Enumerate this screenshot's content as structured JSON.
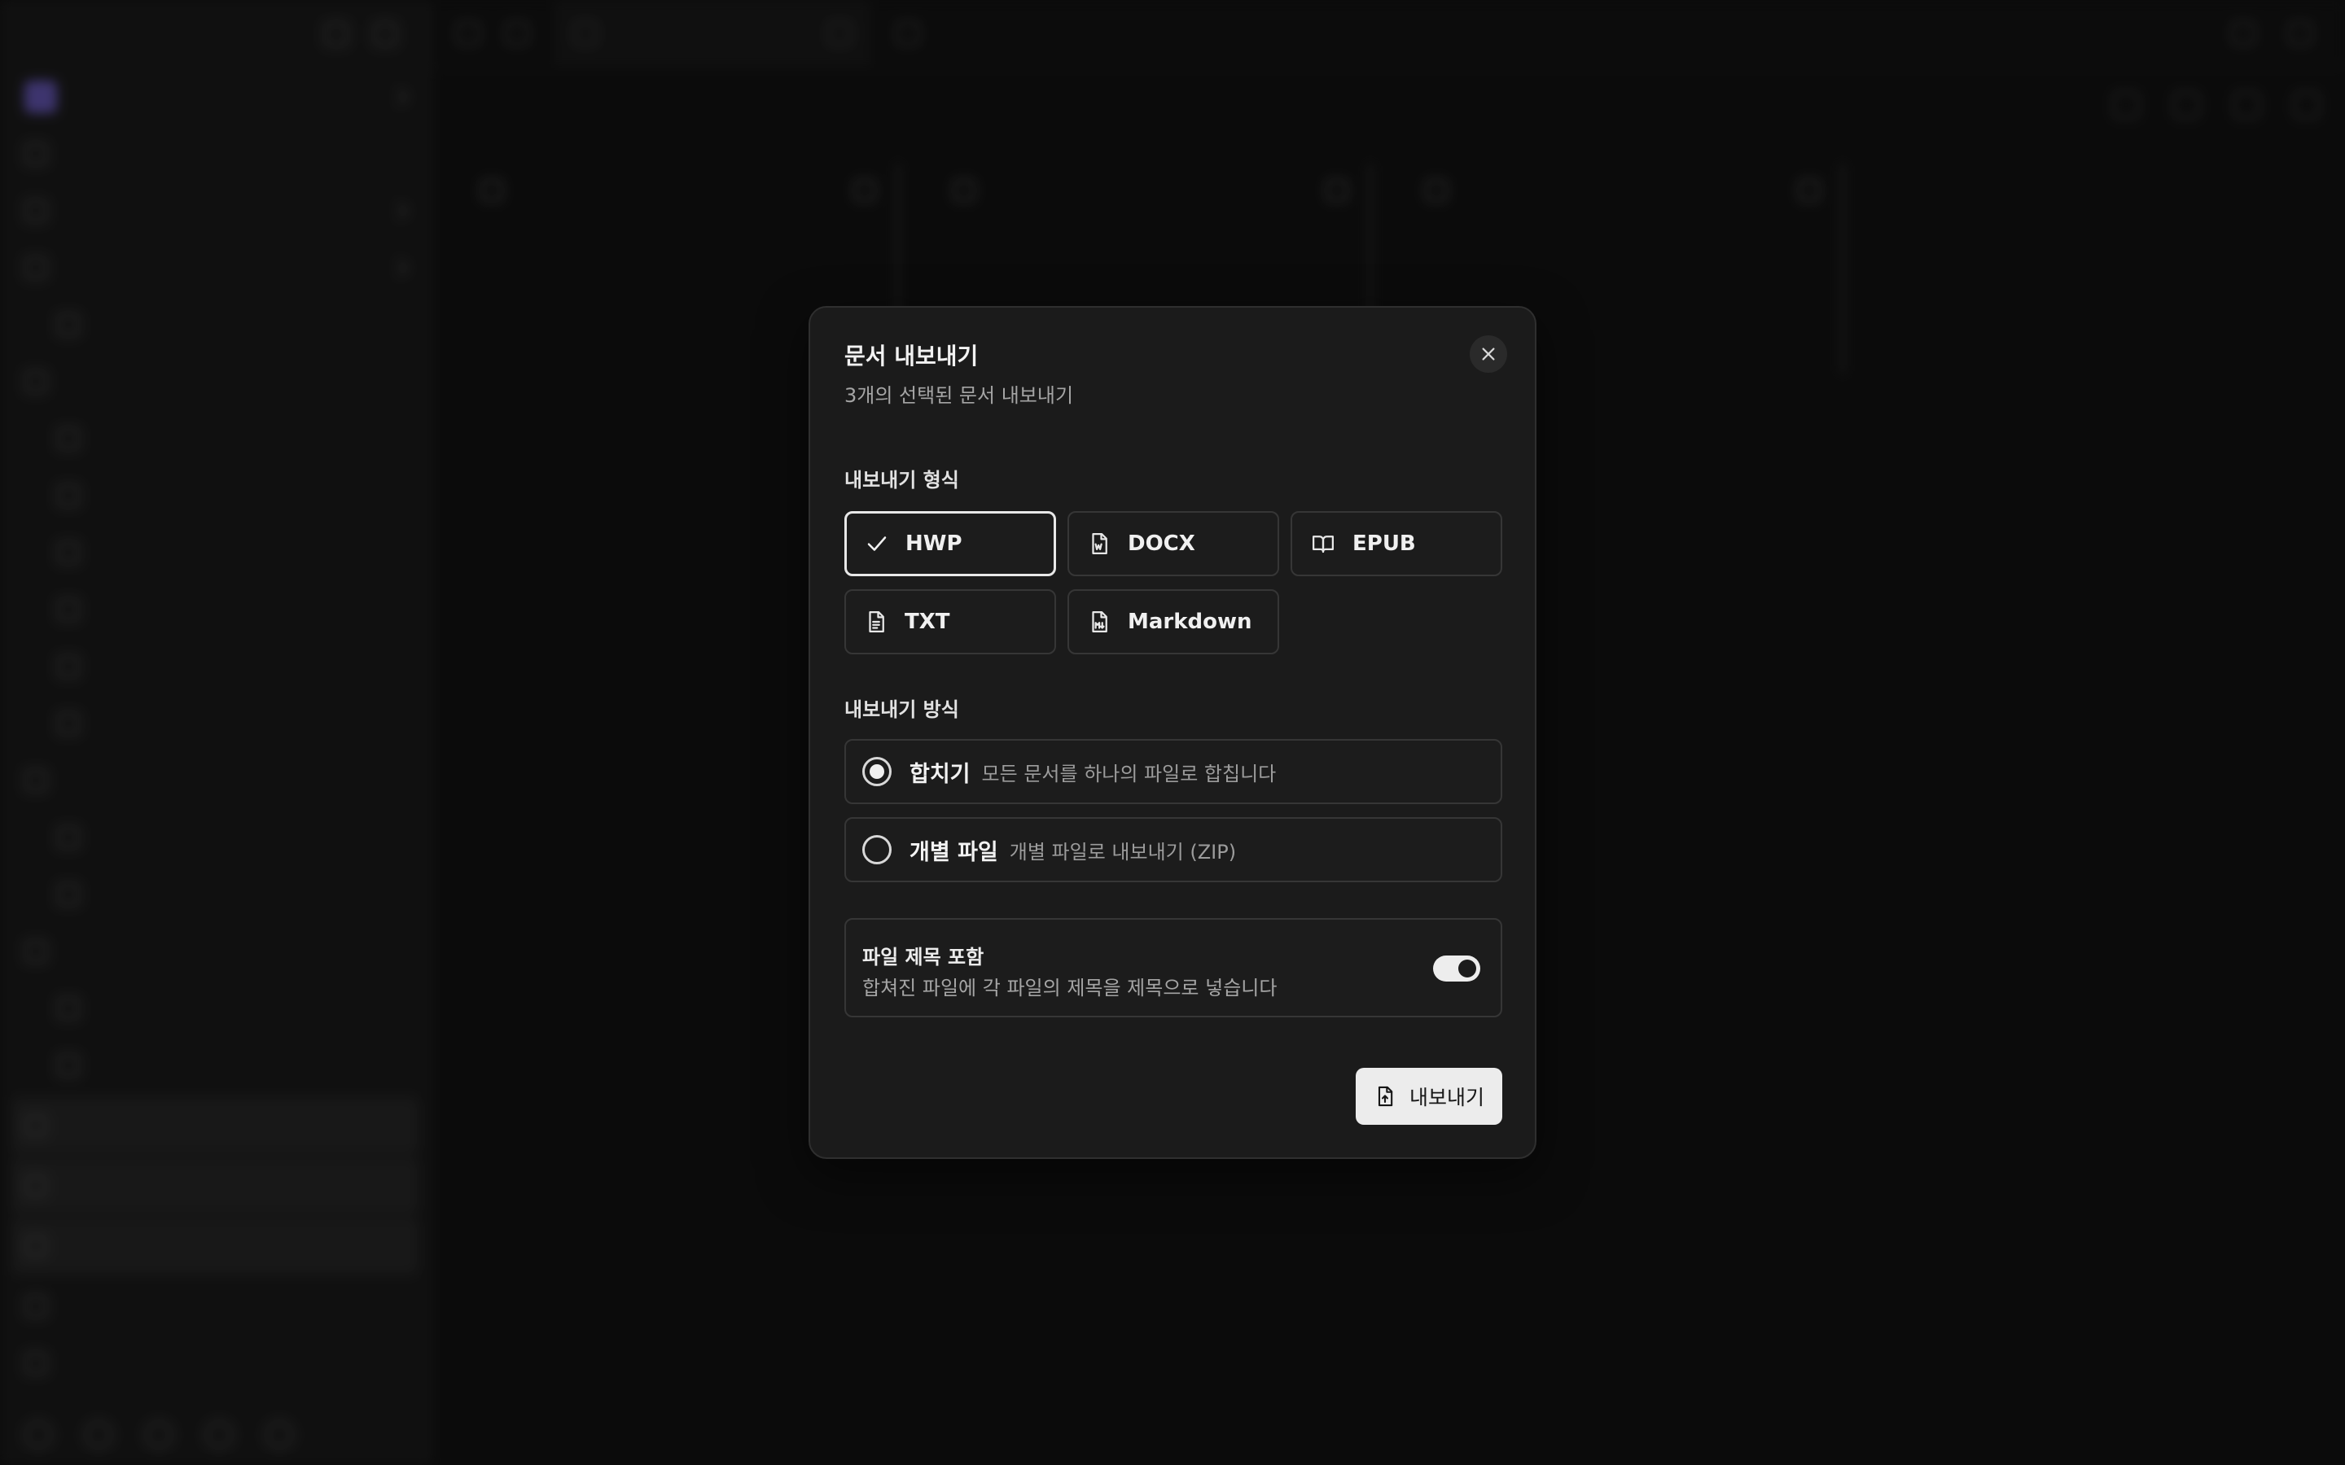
{
  "dialog": {
    "title": "문서 내보내기",
    "description": "3개의 선택된 문서 내보내기",
    "close_icon": "close-icon",
    "format_section": {
      "label": "내보내기 형식",
      "selected": "HWP",
      "options": [
        {
          "label": "HWP",
          "icon": "check-icon"
        },
        {
          "label": "DOCX",
          "icon": "word-file-icon"
        },
        {
          "label": "EPUB",
          "icon": "book-open-icon"
        },
        {
          "label": "TXT",
          "icon": "text-file-icon"
        },
        {
          "label": "Markdown",
          "icon": "markdown-file-icon"
        }
      ]
    },
    "method_section": {
      "label": "내보내기 방식",
      "selected": "merge",
      "options": [
        {
          "label": "합치기",
          "hint": "모든 문서를 하나의 파일로 합칩니다"
        },
        {
          "label": "개별 파일",
          "hint": "개별 파일로 내보내기 (ZIP)"
        }
      ]
    },
    "include_title": {
      "label": "파일 제목 포함",
      "description": "합쳐진 파일에 각 파일의 제목을 제목으로 넣습니다",
      "enabled": true
    },
    "export_button": {
      "label": "내보내기",
      "icon": "file-export-icon"
    }
  },
  "colors": {
    "background": "#141414",
    "dialog_bg": "#1b1b1b",
    "border": "#363636",
    "primary_button_bg": "#ececec",
    "text": "#f0f0f0",
    "muted_text": "#a5a5a5"
  }
}
